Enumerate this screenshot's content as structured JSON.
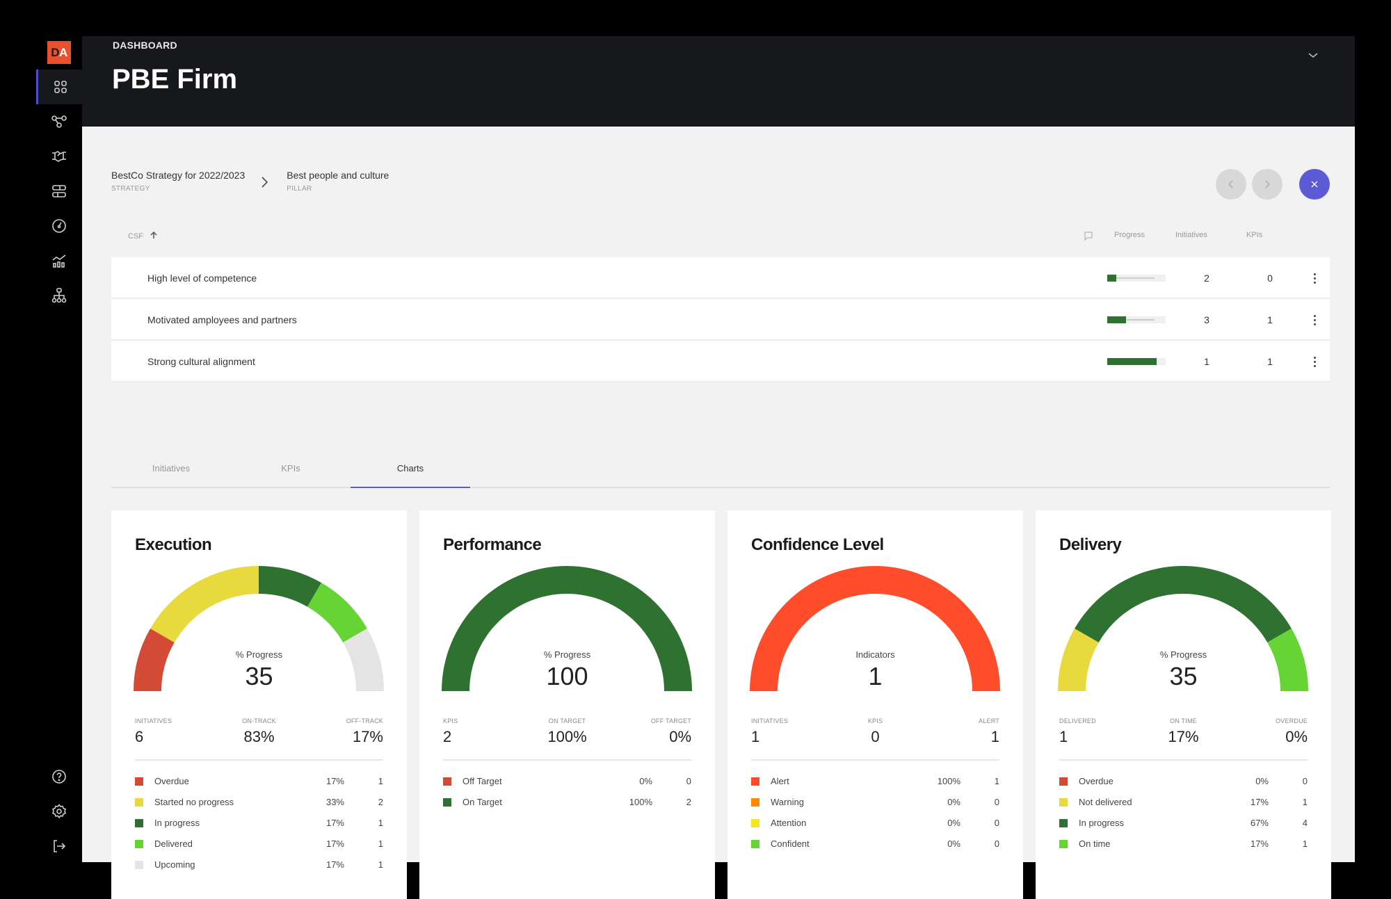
{
  "app": {
    "logo_text_d": "D",
    "logo_text_a": "A"
  },
  "sidebar": {
    "items": [
      {
        "name": "dashboard",
        "icon": "grid-icon",
        "active": true
      },
      {
        "name": "strategy-map",
        "icon": "nodes-icon",
        "active": false
      },
      {
        "name": "partnerships",
        "icon": "handshake-icon",
        "active": false
      },
      {
        "name": "initiatives",
        "icon": "stacked-bars-icon",
        "active": false
      },
      {
        "name": "performance",
        "icon": "gauge-icon",
        "active": false
      },
      {
        "name": "analytics",
        "icon": "chart-trend-icon",
        "active": false
      },
      {
        "name": "organization",
        "icon": "org-chart-icon",
        "active": false
      }
    ],
    "bottom": [
      {
        "name": "help",
        "icon": "help-icon"
      },
      {
        "name": "settings",
        "icon": "gear-icon"
      },
      {
        "name": "logout",
        "icon": "logout-icon"
      }
    ]
  },
  "header": {
    "section": "DASHBOARD",
    "title": "PBE Firm"
  },
  "breadcrumb": [
    {
      "title": "BestCo Strategy for 2022/2023",
      "sub": "STRATEGY"
    },
    {
      "title": "Best people and culture",
      "sub": "PILLAR"
    }
  ],
  "table": {
    "headers": {
      "csf": "CSF",
      "progress": "Progress",
      "initiatives": "Initiatives",
      "kpis": "KPIs"
    },
    "rows": [
      {
        "name": "High level of competence",
        "progress": 0.15,
        "initiatives": "2",
        "kpis": "0"
      },
      {
        "name": "Motivated amployees and partners",
        "progress": 0.32,
        "initiatives": "3",
        "kpis": "1"
      },
      {
        "name": "Strong cultural alignment",
        "progress": 0.85,
        "initiatives": "1",
        "kpis": "1"
      }
    ]
  },
  "tabs": [
    {
      "label": "Initiatives",
      "active": false
    },
    {
      "label": "KPIs",
      "active": false
    },
    {
      "label": "Charts",
      "active": true
    }
  ],
  "colors": {
    "red": "#d34a35",
    "yellow": "#e8d93c",
    "dark_green": "#2e7131",
    "light_green": "#66d434",
    "grey": "#e4e4e4",
    "alert": "#ff4d2b",
    "warning": "#ff8a00",
    "attention": "#f5e51e",
    "accent": "#5b5bd6"
  },
  "chart_data": [
    {
      "type": "pie",
      "title": "Execution",
      "center_label": "% Progress",
      "center_value": "35",
      "stats": [
        {
          "label": "INITIATIVES",
          "value": "6"
        },
        {
          "label": "ON-TRACK",
          "value": "83%"
        },
        {
          "label": "OFF-TRACK",
          "value": "17%"
        }
      ],
      "segments": [
        {
          "label": "Overdue",
          "pct": "17%",
          "count": "1",
          "value": 1,
          "color": "#d34a35"
        },
        {
          "label": "Started no progress",
          "pct": "33%",
          "count": "2",
          "value": 2,
          "color": "#e8d93c"
        },
        {
          "label": "In progress",
          "pct": "17%",
          "count": "1",
          "value": 1,
          "color": "#2e7131"
        },
        {
          "label": "Delivered",
          "pct": "17%",
          "count": "1",
          "value": 1,
          "color": "#66d434"
        },
        {
          "label": "Upcoming",
          "pct": "17%",
          "count": "1",
          "value": 1,
          "color": "#e4e4e4"
        }
      ]
    },
    {
      "type": "pie",
      "title": "Performance",
      "center_label": "% Progress",
      "center_value": "100",
      "stats": [
        {
          "label": "KPIS",
          "value": "2"
        },
        {
          "label": "ON TARGET",
          "value": "100%"
        },
        {
          "label": "OFF TARGET",
          "value": "0%"
        }
      ],
      "segments": [
        {
          "label": "Off Target",
          "pct": "0%",
          "count": "0",
          "value": 0,
          "color": "#d34a35"
        },
        {
          "label": "On Target",
          "pct": "100%",
          "count": "2",
          "value": 2,
          "color": "#2e7131"
        }
      ]
    },
    {
      "type": "pie",
      "title": "Confidence Level",
      "center_label": "Indicators",
      "center_value": "1",
      "stats": [
        {
          "label": "INITIATIVES",
          "value": "1"
        },
        {
          "label": "KPIS",
          "value": "0"
        },
        {
          "label": "ALERT",
          "value": "1"
        }
      ],
      "segments": [
        {
          "label": "Alert",
          "pct": "100%",
          "count": "1",
          "value": 1,
          "color": "#ff4d2b"
        },
        {
          "label": "Warning",
          "pct": "0%",
          "count": "0",
          "value": 0,
          "color": "#ff8a00"
        },
        {
          "label": "Attention",
          "pct": "0%",
          "count": "0",
          "value": 0,
          "color": "#f5e51e"
        },
        {
          "label": "Confident",
          "pct": "0%",
          "count": "0",
          "value": 0,
          "color": "#66d434"
        }
      ]
    },
    {
      "type": "pie",
      "title": "Delivery",
      "center_label": "% Progress",
      "center_value": "35",
      "stats": [
        {
          "label": "DELIVERED",
          "value": "1"
        },
        {
          "label": "ON TIME",
          "value": "17%"
        },
        {
          "label": "OVERDUE",
          "value": "0%"
        }
      ],
      "segments": [
        {
          "label": "Overdue",
          "pct": "0%",
          "count": "0",
          "value": 0,
          "color": "#d34a35"
        },
        {
          "label": "Not delivered",
          "pct": "17%",
          "count": "1",
          "value": 1,
          "color": "#e8d93c"
        },
        {
          "label": "In progress",
          "pct": "67%",
          "count": "4",
          "value": 4,
          "color": "#2e7131"
        },
        {
          "label": "On time",
          "pct": "17%",
          "count": "1",
          "value": 1,
          "color": "#66d434"
        }
      ]
    }
  ]
}
